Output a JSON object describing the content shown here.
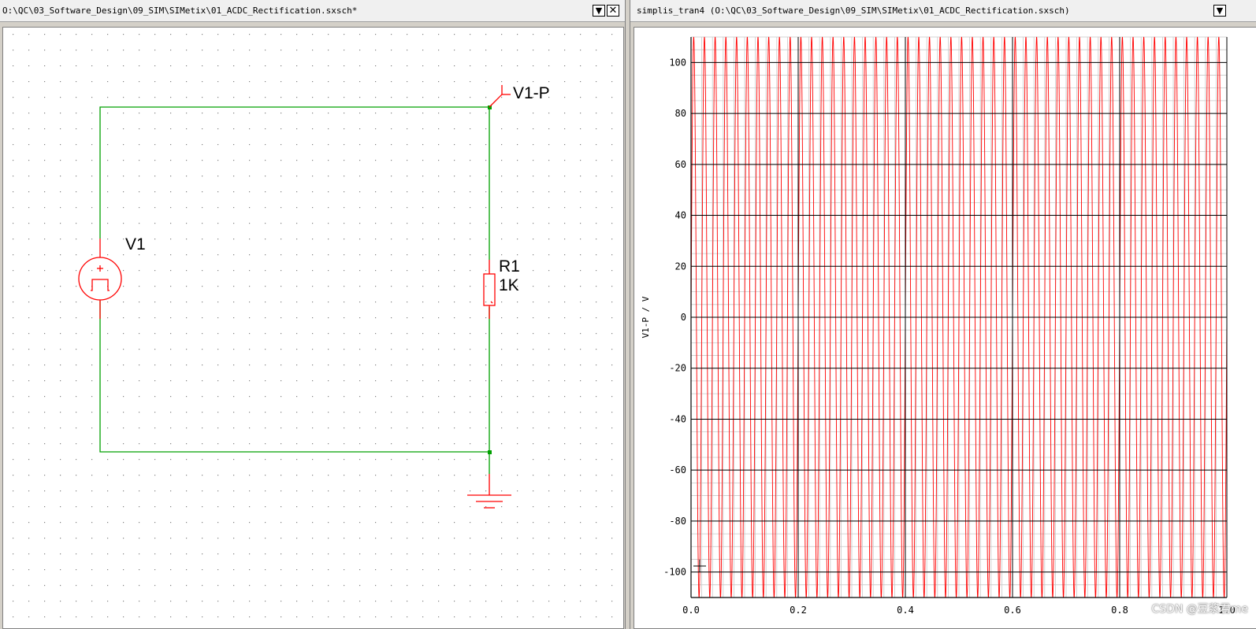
{
  "left_window": {
    "title": "O:\\QC\\03_Software_Design\\09_SIM\\SIMetix\\01_ACDC_Rectification.sxsch*",
    "menu_icon": "dropdown-arrow-icon",
    "close_icon": "close-x-icon",
    "schematic": {
      "components": [
        {
          "ref": "V1",
          "type": "voltage-source-pulse"
        },
        {
          "ref": "R1",
          "value": "1K",
          "type": "resistor"
        },
        {
          "ref": "ground",
          "type": "ground"
        }
      ],
      "probe_label": "V1-P",
      "source_label": "V1",
      "resistor_label": "R1",
      "resistor_value": "1K",
      "colors": {
        "wire": "#00a000",
        "component": "#ff0000",
        "grid": "#808080"
      }
    }
  },
  "right_window": {
    "title": "simplis_tran4 (O:\\QC\\03_Software_Design\\09_SIM\\SIMetix\\01_ACDC_Rectification.sxsch)",
    "menu_icon": "dropdown-arrow-icon",
    "watermark": "CSDN @豆浆君me",
    "chart_data": {
      "type": "line",
      "ylabel": "V1-P / V",
      "xlabel": "",
      "xlim": [
        0.0,
        1.0
      ],
      "ylim": [
        -110,
        110
      ],
      "x_ticks": [
        "0.0",
        "0.2",
        "0.4",
        "0.6",
        "0.8",
        "1.0"
      ],
      "y_ticks": [
        "100",
        "80",
        "60",
        "40",
        "20",
        "0",
        "-20",
        "-40",
        "-60",
        "-80",
        "-100"
      ],
      "grid": true,
      "series": [
        {
          "color": "#ff0000",
          "waveform": "sine",
          "amplitude": 110,
          "cycles": 50
        }
      ]
    }
  }
}
